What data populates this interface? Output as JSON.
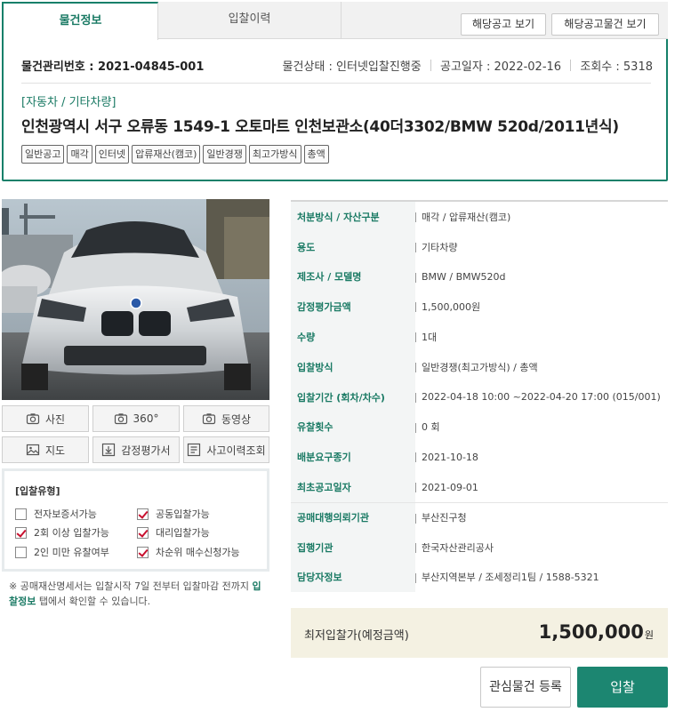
{
  "tabs": {
    "info": "물건정보",
    "bid_history": "입찰이력"
  },
  "buttons": {
    "view_notice": "해당공고 보기",
    "view_notice_items": "해당공고물건 보기"
  },
  "header": {
    "mgmt_label": "물건관리번호 :",
    "mgmt_no": "2021-04845-001",
    "status_label": "물건상태 :",
    "status": "인터넷입찰진행중",
    "notice_date_label": "공고일자 :",
    "notice_date": "2022-02-16",
    "views_label": "조회수 :",
    "views": "5318",
    "category": "[자동차 / 기타차량]",
    "title": "인천광역시 서구 오류동 1549-1 오토마트 인천보관소(40더3302/BMW 520d/2011년식)"
  },
  "tags": [
    "일반공고",
    "매각",
    "인터넷",
    "압류재산(캠코)",
    "일반경쟁",
    "최고가방식",
    "총액"
  ],
  "media_buttons": {
    "photo": "사진",
    "view360": "360°",
    "video": "동영상",
    "map": "지도",
    "appraisal": "감정평가서",
    "accident": "사고이력조회"
  },
  "bid_type": {
    "title": "[입찰유형]",
    "options": [
      {
        "label": "전자보증서가능",
        "checked": false
      },
      {
        "label": "공동입찰가능",
        "checked": true
      },
      {
        "label": "2회 이상 입찰가능",
        "checked": true
      },
      {
        "label": "대리입찰가능",
        "checked": true
      },
      {
        "label": "2인 미만 유찰여부",
        "checked": false
      },
      {
        "label": "차순위 매수신청가능",
        "checked": true
      }
    ]
  },
  "note": {
    "before": "※ 공매재산명세서는 입찰시작 7일 전부터 입찰마감 전까지 ",
    "link": "입찰정보",
    "after": " 탭에서 확인할 수 있습니다."
  },
  "details": [
    {
      "label": "처분방식 / 자산구분",
      "value": "매각 / 압류재산(캠코)"
    },
    {
      "label": "용도",
      "value": "기타차량"
    },
    {
      "label": "제조사 / 모델명",
      "value": "BMW / BMW520d"
    },
    {
      "label": "감정평가금액",
      "value": "1,500,000원"
    },
    {
      "label": "수량",
      "value": "1대"
    },
    {
      "label": "입찰방식",
      "value": "일반경쟁(최고가방식) / 총액"
    },
    {
      "label": "입찰기간 (회차/차수)",
      "value": "2022-04-18 10:00 ~2022-04-20 17:00 (015/001)"
    },
    {
      "label": "유찰횟수",
      "value": "0 회"
    },
    {
      "label": "배분요구종기",
      "value": "2021-10-18"
    },
    {
      "label": "최초공고일자",
      "value": "2021-09-01"
    },
    {
      "label": "공매대행의뢰기관",
      "value": "부산진구청"
    },
    {
      "label": "집행기관",
      "value": "한국자산관리공사"
    },
    {
      "label": "담당자정보",
      "value": "부산지역본부 / 조세정리1팀 / 1588-5321"
    }
  ],
  "price": {
    "label": "최저입찰가(예정금액)",
    "value": "1,500,000",
    "unit": "원"
  },
  "actions": {
    "wish": "관심물건 등록",
    "bid": "입찰"
  },
  "colors": {
    "accent": "#1c8671",
    "checkmark": "#c8102e",
    "price_bg": "#f4f1e2"
  }
}
